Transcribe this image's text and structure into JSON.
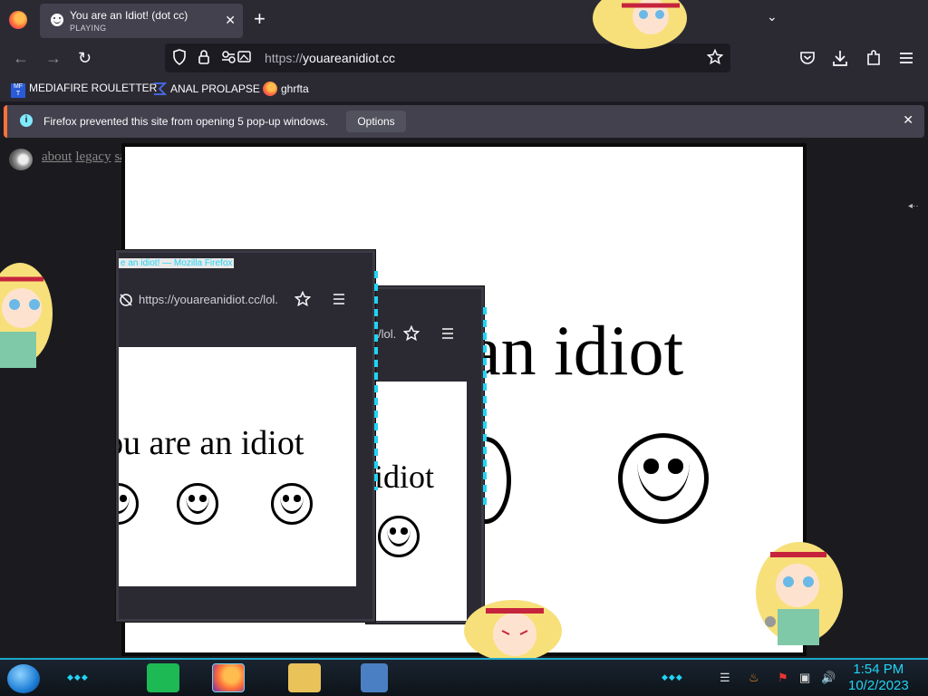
{
  "browser": {
    "tab": {
      "title": "You are an Idiot! (dot cc)",
      "status": "PLAYING",
      "close": "✕"
    },
    "new_tab": "+",
    "tabs_list": "⌄",
    "nav": {
      "back": "←",
      "forward": "→",
      "reload": "↻"
    },
    "url": {
      "protocol": "https://",
      "host": "youareanidiot.cc"
    },
    "bookmarks": [
      {
        "label": "MEDIAFIRE ROULETTER",
        "icon": "mediafire-icon"
      },
      {
        "label": "ANAL PROLAPSE",
        "icon": "bookmark-symbol-icon"
      },
      {
        "label": "ghrfta",
        "icon": "firefox-icon"
      }
    ],
    "notification": {
      "text": "Firefox prevented this site from opening 5 pop-up windows.",
      "button": "Options",
      "close": "✕"
    }
  },
  "page": {
    "links": [
      "about",
      "legacy",
      "safe"
    ],
    "headline": "an idiot",
    "scroll_hint": "◂··"
  },
  "popups": [
    {
      "title": "e an idiot! — Mozilla Firefox",
      "url": "https://youareanidiot.cc/lol.",
      "text": "ou are an idiot"
    },
    {
      "url": "/lol.",
      "text": "idiot"
    }
  ],
  "taskbar": {
    "dots_left": "◆◆◆",
    "dots_right": "◆◆◆",
    "time": "1:54 PM",
    "date": "10/2/2023"
  },
  "colors": {
    "accent": "#22d4f5",
    "firefox_orange": "#ff7139"
  }
}
